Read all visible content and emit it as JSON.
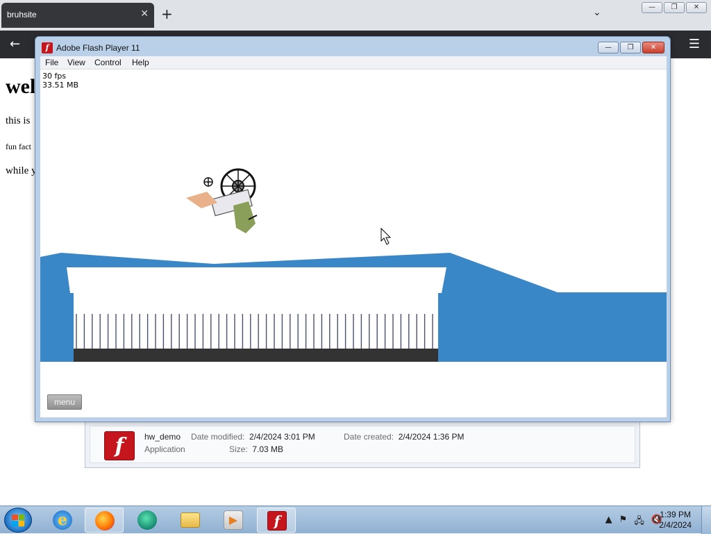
{
  "browser": {
    "tab_title": "bruhsite",
    "tab_close": "✕",
    "new_tab": "+",
    "tab_dropdown": "⌄",
    "back": "←",
    "menu": "☰",
    "window_buttons": [
      "—",
      "❐",
      "✕"
    ]
  },
  "webpage": {
    "heading": "wel",
    "line1": "this is",
    "line2": "fun fact",
    "line3": "while y"
  },
  "flash_window": {
    "title": "Adobe Flash Player 11",
    "icon_letter": "f",
    "buttons": [
      "—",
      "❐",
      "✕"
    ],
    "menu": [
      "File",
      "View",
      "Control",
      "Help"
    ],
    "fps": "30 fps",
    "memory": "33.51 MB",
    "menu_button": "menu",
    "colors": {
      "ground": "#3a87c8",
      "rail": "#333333"
    }
  },
  "file_details": {
    "name": "hw_demo",
    "type": "Application",
    "modified_label": "Date modified:",
    "modified_value": "2/4/2024 3:01 PM",
    "size_label": "Size:",
    "size_value": "7.03 MB",
    "created_label": "Date created:",
    "created_value": "2/4/2024 1:36 PM"
  },
  "taskbar": {
    "apps": [
      "internet-explorer",
      "firefox",
      "edge",
      "file-explorer",
      "media-player",
      "flash-player"
    ],
    "active_app": "firefox",
    "ie_letter": "e",
    "media_glyph": "▶",
    "flash_letter": "f",
    "tray_icons": [
      "▲",
      "⚑",
      "🖧",
      "🔇"
    ],
    "time": "1:39 PM",
    "date": "2/4/2024"
  }
}
